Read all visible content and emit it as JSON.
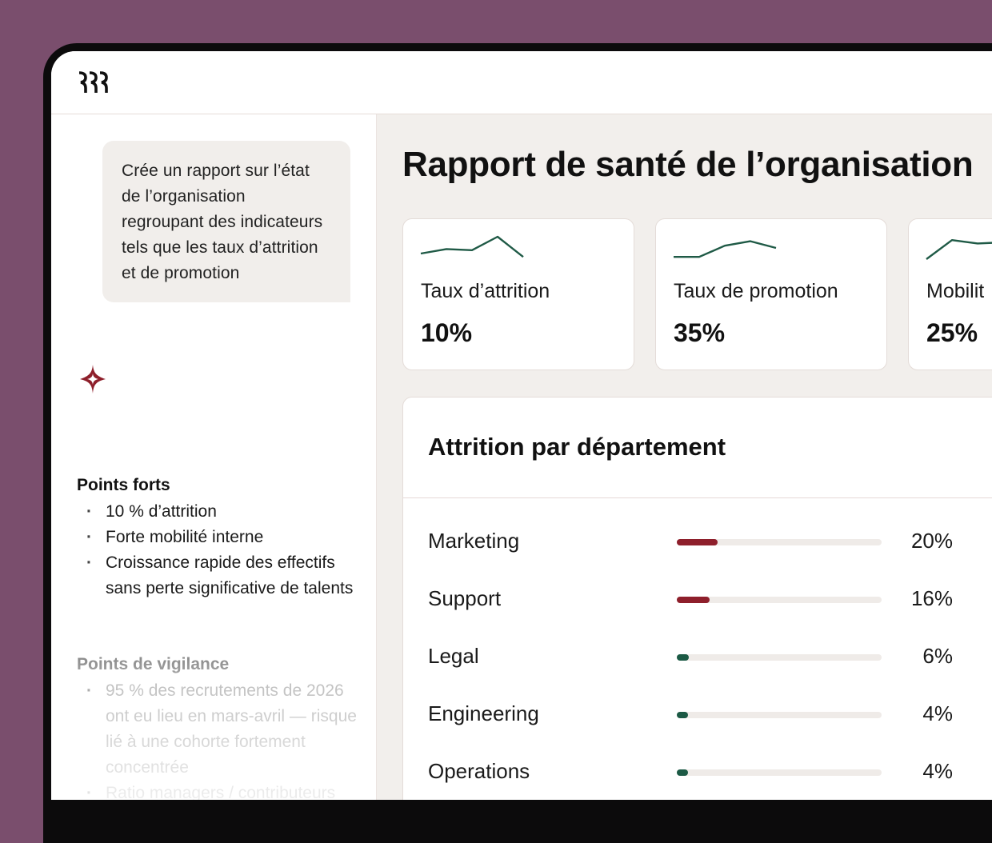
{
  "app": {
    "logo_icon": "three-wave-logo-icon"
  },
  "chat": {
    "prompt": "Crée un rapport sur l’état de l’organisation regroupant des indicateurs tels que les taux d’attrition et de promotion",
    "assistant_icon": "sparkle-icon",
    "strengths": {
      "title": "Points forts",
      "items": [
        "10 % d’attrition",
        "Forte mobilité interne",
        "Croissance rapide des effectifs sans perte significative de talents"
      ]
    },
    "watch_points": {
      "title": "Points de vigilance",
      "items": [
        "95 % des recrutements de 2026 ont eu lieu en mars-avril — risque lié à une cohorte fortement concentrée",
        "Ratio managers / contributeurs individuels de"
      ]
    }
  },
  "report": {
    "title": "Rapport de santé de l’organisation",
    "kpis": [
      {
        "label": "Taux d’attrition",
        "value": "10%",
        "trend": [
          0.25,
          0.45,
          0.4,
          1.0,
          0.1
        ]
      },
      {
        "label": "Taux de promotion",
        "value": "35%",
        "trend": [
          0.1,
          0.1,
          0.6,
          0.8,
          0.5
        ]
      },
      {
        "label": "Mobilit",
        "value": "25%",
        "trend": [
          0.0,
          0.85,
          0.7,
          0.75,
          0.6
        ]
      }
    ],
    "attrition": {
      "title": "Attrition par département",
      "rows": [
        {
          "name": "Marketing",
          "pct": "20%",
          "value": 0.2,
          "color": "#8e1f2b"
        },
        {
          "name": "Support",
          "pct": "16%",
          "value": 0.16,
          "color": "#8e1f2b"
        },
        {
          "name": "Legal",
          "pct": "6%",
          "value": 0.06,
          "color": "#1c5a45"
        },
        {
          "name": "Engineering",
          "pct": "4%",
          "value": 0.04,
          "color": "#1c5a45"
        },
        {
          "name": "Operations",
          "pct": "4%",
          "value": 0.04,
          "color": "#1c5a45"
        }
      ]
    }
  },
  "colors": {
    "background": "#7a4e6d",
    "accent_red": "#8e1f2b",
    "accent_green": "#1c5a45",
    "sparkline": "#1f5a46"
  }
}
